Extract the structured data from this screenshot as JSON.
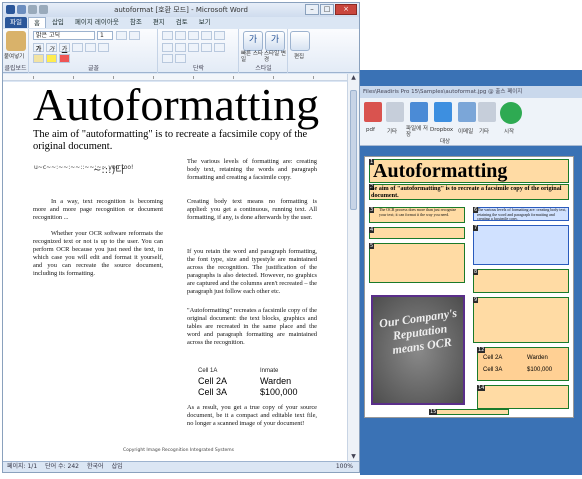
{
  "word": {
    "title": "autoformat [호환 모드] - Microsoft Word",
    "controls": {
      "minimize": "–",
      "maximize": "□",
      "close": "×"
    },
    "tabs": [
      {
        "label": "파일"
      },
      {
        "label": "홈"
      },
      {
        "label": "삽입"
      },
      {
        "label": "페이지 레이아웃"
      },
      {
        "label": "참조"
      },
      {
        "label": "편지"
      },
      {
        "label": "검토"
      },
      {
        "label": "보기"
      }
    ],
    "ribbon": {
      "paste_label": "붙여넣기",
      "font_name": "맑은 고딕",
      "font_size": "1",
      "styles_quick": "빠른 스타일",
      "styles_change": "스타일 변경",
      "edit_label": "편집",
      "groups": [
        "클립보드",
        "글꼴",
        "단락",
        "스타일"
      ]
    },
    "status": {
      "page": "페이지: 1/1",
      "words": "단어 수: 242",
      "lang": "한국어",
      "mode": "삽입",
      "zoom": "100%"
    },
    "document": {
      "title": "Autoformatting",
      "lead": "The aim of \"autoformatting\" is to recreate a facsimile copy of the original document.",
      "symbols_small": "u~c~~:~~:~~::~~:~~ you too!",
      "symbols_large": "~:::)다",
      "left_par1": "In a way, text recognition is becoming more and more page recognition or document recognition ...",
      "left_par2": "Whether your OCR software reformats the recognized text or not is up to the user. You can perform OCR because you just need the text, in which case you will edit and format it yourself, and you can recreate the source document, including its formatting.",
      "right_par1": "The various levels of formatting are: creating body text, retaining the words and paragraph formatting and creating a facsimile copy.",
      "right_par2": "Creating body text means no formatting is applied: you get a continuous, running text. All formatting, if any, is done afterwards by the user.",
      "right_par3": "If you retain the word and paragraph formatting, the font type, size and typestyle are maintained across the recognition. The justification of the paragraphs is also detected. However, no graphics are captured and the columns aren't recreated – the paragraph just follow each other etc.",
      "right_par4": "\"Autoformatting\" recreates a facsimile copy of the original document: the text blocks, graphics and tables are recreated in the same place and the word and paragraph formatting are maintained across the recognition.",
      "table": {
        "h1": "Cell 1A",
        "h2": "Inmate",
        "r1c1": "Cell 2A",
        "r1c2": "Warden",
        "r2c1": "Cell 3A",
        "r2c2": "$100,000"
      },
      "right_par5": "As a result, you get a true copy of your source document, be it a compact and editable text file, no longer a scanned image of your document!",
      "copyright": "Copyright Image Recognition Integrated Systems"
    }
  },
  "finereader": {
    "path": "Files\\Readiris Pro 15\\Samples\\autoformat.jpg @ 출스 페이지",
    "buttons": [
      {
        "label": "pdf"
      },
      {
        "label": "기타"
      },
      {
        "label": "파일에 저장"
      },
      {
        "label": "Dropbox"
      },
      {
        "label": "이메일"
      },
      {
        "label": "기타"
      },
      {
        "label": "시작"
      }
    ],
    "section_label": "대상",
    "doc_title": "Autoformatting",
    "lead": "he aim of \"autoformatting\" is to recreate a facsimile copy of the original document.",
    "image_text": "Our Company's Reputation means OCR",
    "zone_text_left": "The OCR process does more than just recognize your text; it can format it the way you need.",
    "zone_text_right": "The various levels of formatting are: creating body text, retaining the word and paragraph formatting and creating a facsimile copy.",
    "table": {
      "c1": "Cell 2A",
      "c2": "Warden",
      "c3": "Cell 3A",
      "c4": "$100,000"
    }
  }
}
